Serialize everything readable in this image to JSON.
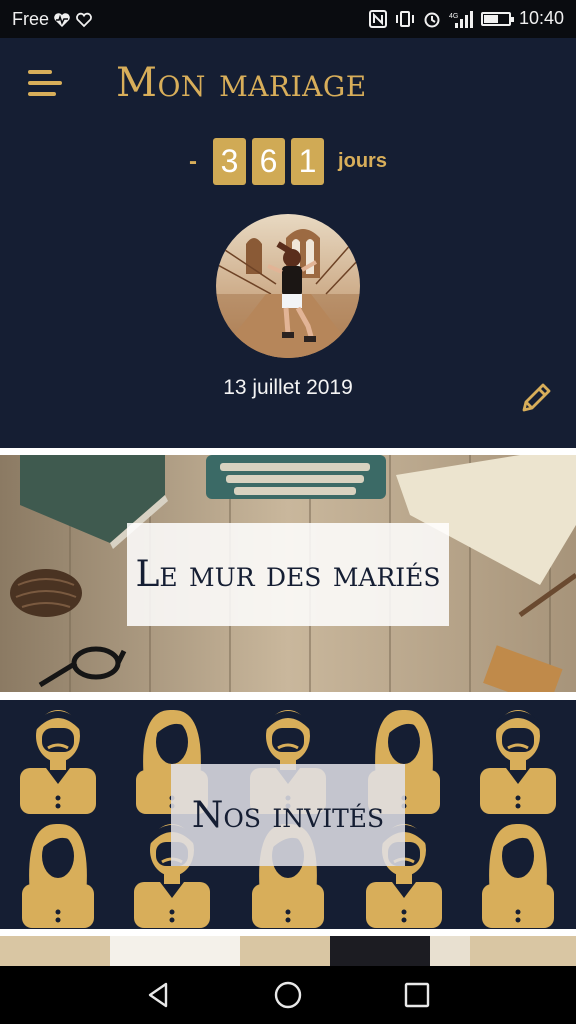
{
  "status_bar": {
    "carrier": "Free",
    "time": "10:40",
    "battery_level": 0.55,
    "icons": [
      "health-icon",
      "heart-outline-icon",
      "nfc-icon",
      "vibrate-icon",
      "alarm-icon",
      "signal-icon",
      "battery-icon"
    ]
  },
  "header": {
    "title": "Mon mariage",
    "menu_icon": "hamburger-menu-icon",
    "countdown": {
      "prefix": "-",
      "digits": [
        "3",
        "6",
        "1"
      ],
      "unit": "jours"
    },
    "date": "13 juillet 2019",
    "edit_icon": "pencil-icon"
  },
  "cards": [
    {
      "label": "Le mur des mariés"
    },
    {
      "label": "Nos invités"
    }
  ],
  "colors": {
    "navy": "#151e33",
    "gold": "#d8ae5a"
  },
  "nav_bar": {
    "icons": [
      "back-icon",
      "home-icon",
      "recents-icon"
    ]
  }
}
